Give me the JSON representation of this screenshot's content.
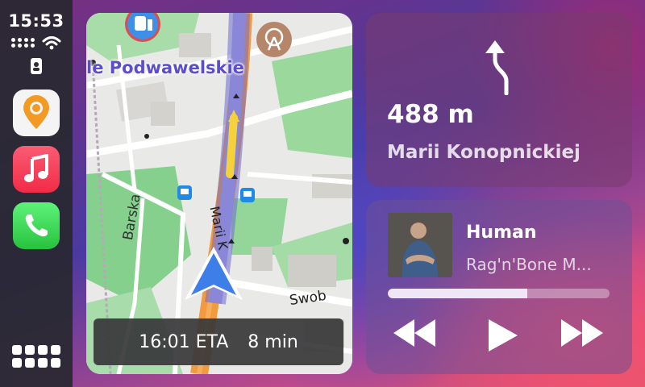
{
  "status_bar": {
    "time": "15:53"
  },
  "dock": {
    "apps": [
      {
        "name": "Maps",
        "icon": "map-pin-icon"
      },
      {
        "name": "Music",
        "icon": "music-note-icon"
      },
      {
        "name": "Phone",
        "icon": "phone-icon"
      }
    ],
    "grid_icon": "app-grid-icon"
  },
  "map": {
    "street_top": "le Podwawelskie",
    "street_barska": "Barska",
    "street_marii": "Marii K",
    "street_swob": "Swob",
    "eta_time": "16:01 ETA",
    "eta_duration": "8 min"
  },
  "maneuver": {
    "distance": "488 m",
    "street": "Marii Konopnickiej",
    "icon": "turn-slight-left-arrow-icon"
  },
  "now_playing": {
    "title": "Human",
    "artist": "Rag'n'Bone M...",
    "progress": 0.63,
    "controls": [
      "rewind-icon",
      "play-icon",
      "fast-forward-icon"
    ]
  },
  "colors": {
    "route": "#8a86d8",
    "road_major": "#f19a3e",
    "park": "#8fd59a",
    "position_marker": "#3d7ee8"
  }
}
